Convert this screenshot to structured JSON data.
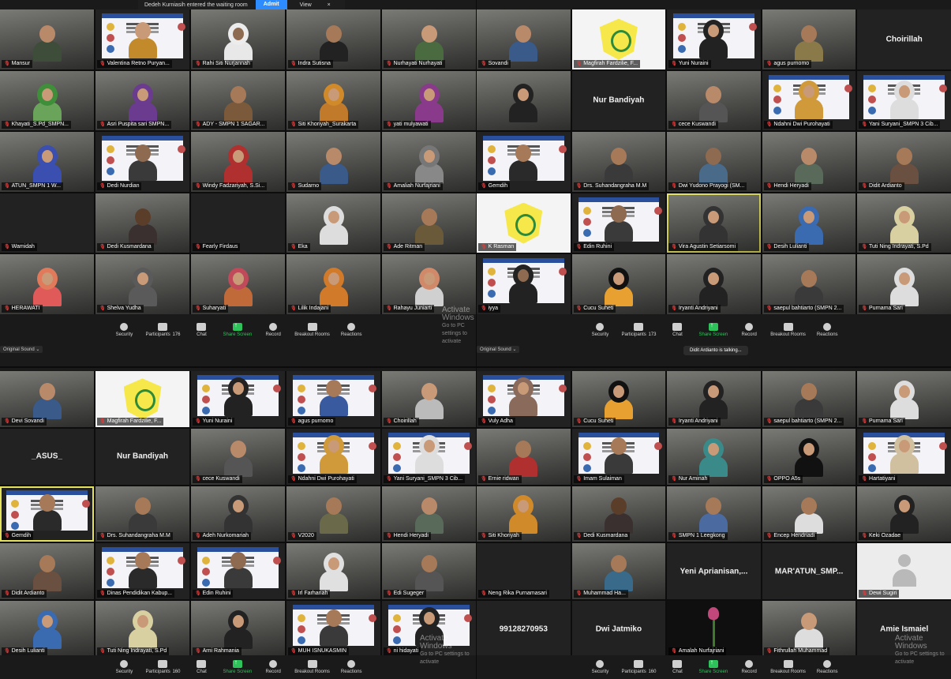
{
  "waiting_room": {
    "text": "Dedeh Kurniasih entered the waiting room",
    "admit": "Admit",
    "view": "View",
    "close": "×"
  },
  "toolbar": {
    "security": "Security",
    "participants": "Participants",
    "chat": "Chat",
    "share": "Share Screen",
    "record": "Record",
    "breakout": "Breakout Rooms",
    "reactions": "Reactions"
  },
  "original_sound": "Original Sound ⌄",
  "talking_indicator": "Didit Ardianto is talking...",
  "watermark": {
    "title": "Activate Windows",
    "sub": "Go to PC settings to activate"
  },
  "quadrants": {
    "tl": {
      "participants_count": "176",
      "tiles": [
        {
          "name": "Mansur",
          "type": "video",
          "head": "#b98a6a",
          "body": "#3e4d3a"
        },
        {
          "name": "Valentina Retno Puryan...",
          "type": "banner",
          "head": "#c99a78",
          "body": "#c28a2a"
        },
        {
          "name": "Rahi Siti Nurjannah",
          "type": "video",
          "head": "#8e6a50",
          "body": "#e8e8e8",
          "hijab": "#ececec"
        },
        {
          "name": "Indra Sutisna",
          "type": "video",
          "head": "#a67a58",
          "body": "#222"
        },
        {
          "name": "Nurhayati Nurhayati",
          "type": "video",
          "head": "#c99a78",
          "body": "#4a6a40"
        },
        {
          "name": "Khayati_S.Pd_SMPN...",
          "type": "video",
          "head": "#c99a78",
          "body": "#6aa35a",
          "hijab": "#3f8f3a"
        },
        {
          "name": "Asri Puspita sari SMPN...",
          "type": "video",
          "head": "#c99a78",
          "body": "#6a3b8f",
          "hijab": "#6a3b8f"
        },
        {
          "name": "ADY - SMPN 1 SAGAR...",
          "type": "video",
          "head": "#a67a58",
          "body": "#7a5a3a"
        },
        {
          "name": "Siti Khoriyah_Surakarta",
          "type": "video",
          "head": "#c99a78",
          "body": "#c07a2a",
          "hijab": "#d08a2a"
        },
        {
          "name": "yati mulyawati",
          "type": "video",
          "head": "#c99a78",
          "body": "#8a3a8a",
          "hijab": "#8a3a8a"
        },
        {
          "name": "ATUN_SMPN 1 W...",
          "type": "video",
          "head": "#c99a78",
          "body": "#3a4fb0",
          "hijab": "#3a4fb0"
        },
        {
          "name": "Dedi Nurdian",
          "type": "banner",
          "head": "#8e6a50",
          "body": "#3a3a3a"
        },
        {
          "name": "Windy Fadzariyah, S.Si...",
          "type": "video",
          "head": "#c99a78",
          "body": "#b03030",
          "hijab": "#b03030"
        },
        {
          "name": "Sudarno",
          "type": "video",
          "head": "#b98a6a",
          "body": "#3a5a8a"
        },
        {
          "name": "Amaliah Nurfajriani",
          "type": "video",
          "head": "#c99a78",
          "body": "#888",
          "hijab": "#777"
        },
        {
          "name": "Wamidah",
          "type": "empty"
        },
        {
          "name": "Dedi Kusmardana",
          "type": "video",
          "head": "#5a3e2a",
          "body": "#3a3030"
        },
        {
          "name": "Fearly Firdaus",
          "type": "empty"
        },
        {
          "name": "Eka",
          "type": "video",
          "head": "#c99a78",
          "body": "#ddd",
          "hijab": "#ddd"
        },
        {
          "name": "Ade Ritman",
          "type": "video",
          "head": "#a67a58",
          "body": "#6a5a3a"
        },
        {
          "name": "HERAWATI",
          "type": "video",
          "head": "#c99a78",
          "body": "#e05a5a",
          "hijab": "#e07a5a"
        },
        {
          "name": "Shelva Yudha",
          "type": "video",
          "head": "#c99a78",
          "body": "#5a5a5a",
          "hijab": "#5a5a5a"
        },
        {
          "name": "Suharyati",
          "type": "video",
          "head": "#c99a78",
          "body": "#c06a3a",
          "hijab": "#c04a5a"
        },
        {
          "name": "Lilik Indajani",
          "type": "video",
          "head": "#c99a78",
          "body": "#d07a2a",
          "hijab": "#d07a2a"
        },
        {
          "name": "Rahayu Juniarti",
          "type": "video",
          "head": "#c99a78",
          "body": "#d0d0d0",
          "hijab": "#d08a6a"
        }
      ]
    },
    "tr": {
      "participants_count": "173",
      "tiles": [
        {
          "name": "Sovandi",
          "type": "video",
          "head": "#b98a6a",
          "body": "#3a5a8a"
        },
        {
          "name": "Magfirah Fardzilie, F...",
          "type": "emblem"
        },
        {
          "name": "Yuni Nuraini",
          "type": "banner",
          "head": "#c99a78",
          "body": "#222",
          "hijab": "#222"
        },
        {
          "name": "agus purnomo",
          "type": "video",
          "head": "#a67a58",
          "body": "#8a7a4a"
        },
        {
          "name": "Choirillah",
          "type": "name"
        },
        {
          "name": "",
          "type": "video",
          "head": "#c99a78",
          "body": "#222",
          "hijab": "#222"
        },
        {
          "name": "Nur Bandiyah",
          "type": "name"
        },
        {
          "name": "cece Kuswandi",
          "type": "video",
          "head": "#b98a6a",
          "body": "#555"
        },
        {
          "name": "Ndahni Dwi Purohayati",
          "type": "banner",
          "head": "#c99a78",
          "body": "#d09a3a",
          "hijab": "#d09a3a"
        },
        {
          "name": "Yani Suryani_SMPN 3 Cib...",
          "type": "banner",
          "head": "#c99a78",
          "body": "#ddd",
          "hijab": "#ddd"
        },
        {
          "name": "Gemdih",
          "type": "banner",
          "head": "#a67a58",
          "body": "#2a2a2a"
        },
        {
          "name": "Drs. Suhandangraha M.M",
          "type": "video",
          "head": "#a67a58",
          "body": "#3a3a3a"
        },
        {
          "name": "Dwi Yudono Prayogi (SM...",
          "type": "video",
          "head": "#8e6a50",
          "body": "#4a6a8a"
        },
        {
          "name": "Hendi Heryadi",
          "type": "video",
          "head": "#b98a6a",
          "body": "#5a6a5a"
        },
        {
          "name": "Didit Ardianto",
          "type": "video",
          "head": "#a67a58",
          "body": "#6a5040"
        },
        {
          "name": "K Rasman",
          "type": "emblem"
        },
        {
          "name": "Edin Ruhini",
          "type": "banner",
          "head": "#8e6a50",
          "body": "#3a3a3a"
        },
        {
          "name": "Vira Agustin Setiarsomi",
          "type": "video",
          "head": "#c99a78",
          "body": "#333",
          "hijab": "#333",
          "speaking": true
        },
        {
          "name": "Desih Lulianti",
          "type": "video",
          "head": "#c99a78",
          "body": "#3a6ab0",
          "hijab": "#3a6ab0"
        },
        {
          "name": "Tuti Ning Indrayati, S.Pd",
          "type": "video",
          "head": "#c99a78",
          "body": "#d8d0a0",
          "hijab": "#d8d0a0"
        },
        {
          "name": "iyya",
          "type": "banner",
          "head": "#8e6a50",
          "body": "#222",
          "hijab": "#222"
        },
        {
          "name": "Cucu Suheti",
          "type": "video",
          "head": "#c99a78",
          "body": "#e8a030",
          "hijab": "#111"
        },
        {
          "name": "Iryanti Andriyani",
          "type": "video",
          "head": "#c99a78",
          "body": "#222",
          "hijab": "#222"
        },
        {
          "name": "saepul bahtiarto (SMPN 2...",
          "type": "video",
          "head": "#a67a58",
          "body": "#3a3a3a"
        },
        {
          "name": "Purnama Sari",
          "type": "video",
          "head": "#c99a78",
          "body": "#ddd",
          "hijab": "#ddd"
        }
      ]
    },
    "bl": {
      "participants_count": "160",
      "tiles": [
        {
          "name": "Devi Sovandi",
          "type": "video",
          "head": "#b98a6a",
          "body": "#3a5a8a"
        },
        {
          "name": "Magfirah Fardzilie, F...",
          "type": "emblem"
        },
        {
          "name": "Yuni Nuraini",
          "type": "banner",
          "head": "#c99a78",
          "body": "#222",
          "hijab": "#222"
        },
        {
          "name": "agus purnomo",
          "type": "banner",
          "head": "#a67a58",
          "body": "#3a5aa0"
        },
        {
          "name": "Choirillah",
          "type": "video",
          "head": "#c99a78",
          "body": "#bbb"
        },
        {
          "name": "_ASUS_",
          "type": "name"
        },
        {
          "name": "Nur Bandiyah",
          "type": "name"
        },
        {
          "name": "cece Kuswandi",
          "type": "video",
          "head": "#b98a6a",
          "body": "#555"
        },
        {
          "name": "Ndahni Dwi Purohayati",
          "type": "banner",
          "head": "#c99a78",
          "body": "#d09a3a",
          "hijab": "#d09a3a"
        },
        {
          "name": "Yani Suryani_SMPN 3 Cib...",
          "type": "banner",
          "head": "#c99a78",
          "body": "#ddd",
          "hijab": "#ddd"
        },
        {
          "name": "Gemdih",
          "type": "banner",
          "head": "#a67a58",
          "body": "#2a2a2a",
          "speaking": true
        },
        {
          "name": "Drs. Suhandangraha M.M",
          "type": "video",
          "head": "#a67a58",
          "body": "#3a3a3a"
        },
        {
          "name": "Adeh Nurkomariah",
          "type": "video",
          "head": "#c99a78",
          "body": "#333",
          "hijab": "#333"
        },
        {
          "name": "V2020",
          "type": "video",
          "head": "#a67a58",
          "body": "#6a6a4a"
        },
        {
          "name": "Hendi Heryadi",
          "type": "video",
          "head": "#b98a6a",
          "body": "#5a6a5a"
        },
        {
          "name": "Didit Ardianto",
          "type": "video",
          "head": "#a67a58",
          "body": "#6a5040"
        },
        {
          "name": "Dinas Pendidikan Kabup...",
          "type": "banner",
          "head": "#a67a58",
          "body": "#2a2a2a"
        },
        {
          "name": "Edin Ruhini",
          "type": "banner",
          "head": "#8e6a50",
          "body": "#3a3a3a"
        },
        {
          "name": "Irl Farhanah",
          "type": "video",
          "head": "#c99a78",
          "body": "#e0e0e0",
          "hijab": "#e0e0e0"
        },
        {
          "name": "Edi Sugeger",
          "type": "video",
          "head": "#a67a58",
          "body": "#555"
        },
        {
          "name": "Desih Lulianti",
          "type": "video",
          "head": "#c99a78",
          "body": "#3a6ab0",
          "hijab": "#3a6ab0"
        },
        {
          "name": "Tuti Ning Indrayati, S.Pd",
          "type": "video",
          "head": "#c99a78",
          "body": "#d8d0a0",
          "hijab": "#d8d0a0"
        },
        {
          "name": "Arni Rahmania",
          "type": "video",
          "head": "#c99a78",
          "body": "#222",
          "hijab": "#222"
        },
        {
          "name": "MUH ISNUKASMIN",
          "type": "banner",
          "head": "#a67a58",
          "body": "#3a3a3a"
        },
        {
          "name": "ni hidayati",
          "type": "banner",
          "head": "#c99a78",
          "body": "#222",
          "hijab": "#222"
        }
      ]
    },
    "br": {
      "participants_count": "160",
      "tiles": [
        {
          "name": "Vuly Adha",
          "type": "banner",
          "head": "#c99a78",
          "body": "#8a6a5a",
          "hijab": "#8a6a5a"
        },
        {
          "name": "Cucu Suheti",
          "type": "video",
          "head": "#c99a78",
          "body": "#e8a030",
          "hijab": "#111"
        },
        {
          "name": "Iryanti Andriyani",
          "type": "video",
          "head": "#c99a78",
          "body": "#222",
          "hijab": "#222"
        },
        {
          "name": "saepul bahtiarto (SMPN 2...",
          "type": "video",
          "head": "#a67a58",
          "body": "#3a3a3a"
        },
        {
          "name": "Purnama Sari",
          "type": "video",
          "head": "#c99a78",
          "body": "#ddd",
          "hijab": "#ddd"
        },
        {
          "name": "Ernie ridwan",
          "type": "video",
          "head": "#a67a58",
          "body": "#b03030"
        },
        {
          "name": "Imam Sulaiman",
          "type": "banner",
          "head": "#a67a58",
          "body": "#3a3a3a"
        },
        {
          "name": "Nur Aminah",
          "type": "video",
          "head": "#c99a78",
          "body": "#3a8a8a",
          "hijab": "#3a8a8a"
        },
        {
          "name": "OPPO A5s",
          "type": "video",
          "head": "#c99a78",
          "body": "#111",
          "hijab": "#111"
        },
        {
          "name": "Hartatiyani",
          "type": "banner",
          "head": "#c99a78",
          "body": "#d0c0a0",
          "hijab": "#d0c0a0"
        },
        {
          "name": "Siti Khoriyah",
          "type": "video",
          "head": "#c99a78",
          "body": "#d08a2a",
          "hijab": "#d08a2a"
        },
        {
          "name": "Dedi Kusmardana",
          "type": "video",
          "head": "#5a3e2a",
          "body": "#3a3030"
        },
        {
          "name": "SMPN 1 Leegkong",
          "type": "video",
          "head": "#a67a58",
          "body": "#4a6aa0"
        },
        {
          "name": "Encep Hendriadi",
          "type": "video",
          "head": "#a67a58",
          "body": "#ddd"
        },
        {
          "name": "Keki Ozadae",
          "type": "video",
          "head": "#c99a78",
          "body": "#222",
          "hijab": "#222"
        },
        {
          "name": "Neng Rika Purnamasari",
          "type": "empty"
        },
        {
          "name": "Muhammad Ha...",
          "type": "video",
          "head": "#a67a58",
          "body": "#3a6a8a"
        },
        {
          "name": "Yeni Aprianisan,...",
          "type": "name"
        },
        {
          "name": "MAR'ATUN_SMP...",
          "type": "name"
        },
        {
          "name": "Dewi Sugiri",
          "type": "avatar"
        },
        {
          "name": "99128270953",
          "type": "name"
        },
        {
          "name": "Dwi Jatmiko",
          "type": "name"
        },
        {
          "name": "Amalah Nurfajriani",
          "type": "flower"
        },
        {
          "name": "Fithrullah Muhammad",
          "type": "video",
          "head": "#c99a78",
          "body": "#ddd"
        },
        {
          "name": "Amie Ismaiel",
          "type": "name"
        }
      ]
    }
  }
}
